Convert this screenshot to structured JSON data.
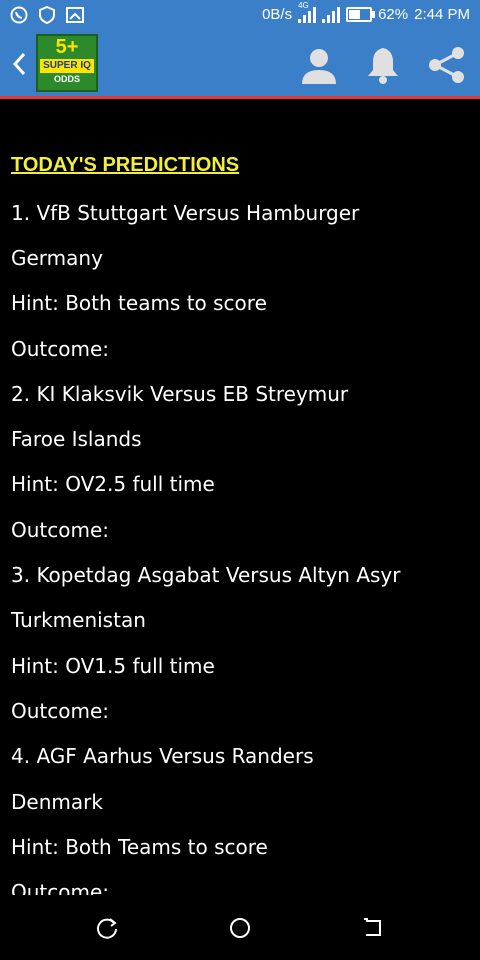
{
  "status_bar": {
    "net_speed": "0B/s",
    "network_type": "4G",
    "battery": "62%",
    "battery_level": 0.62,
    "time": "2:44 PM",
    "icons": [
      "whatsapp-icon",
      "shield-icon",
      "screenshot-icon",
      "signal-icon",
      "signal-icon",
      "battery-icon"
    ]
  },
  "app_bar": {
    "logo": {
      "line1": "5+",
      "line2": "SUPER IQ",
      "line3": "ODDS"
    },
    "accent_color": "#3a7fc7",
    "divider_color": "#e53935",
    "icons": [
      "back-icon",
      "user-icon",
      "bell-icon",
      "share-icon"
    ]
  },
  "content": {
    "heading": "TODAY'S PREDICTIONS",
    "heading_color": "#f2ef3a",
    "predictions": [
      {
        "match": "1. VfB Stuttgart Versus Hamburger",
        "country": "Germany",
        "hint": "Hint: Both teams to score",
        "outcome": "Outcome:"
      },
      {
        "match": "2. KI Klaksvik Versus EB Streymur",
        "country": "Faroe Islands",
        "hint": "Hint: OV2.5 full time",
        "outcome": "Outcome:"
      },
      {
        "match": "3. Kopetdag Asgabat Versus Altyn Asyr",
        "country": "Turkmenistan",
        "hint": "Hint: OV1.5 full time",
        "outcome": "Outcome:"
      },
      {
        "match": "4. AGF Aarhus Versus Randers",
        "country": "Denmark",
        "hint": "Hint: Both Teams to score",
        "outcome": "Outcome:"
      }
    ]
  },
  "nav_bar": {
    "icons": [
      "back-nav-icon",
      "home-icon",
      "recent-apps-icon"
    ]
  }
}
